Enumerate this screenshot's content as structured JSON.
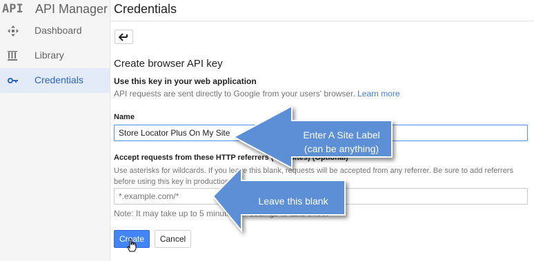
{
  "sidebar": {
    "logo": "API",
    "app_name": "API Manager",
    "items": [
      {
        "label": "Dashboard",
        "icon": "dashboard-icon",
        "active": false
      },
      {
        "label": "Library",
        "icon": "library-icon",
        "active": false
      },
      {
        "label": "Credentials",
        "icon": "key-icon",
        "active": true
      }
    ]
  },
  "header": {
    "title": "Credentials"
  },
  "form": {
    "back_icon": "back-arrow-icon",
    "title": "Create browser API key",
    "section_heading": "Use this key in your web application",
    "help_text": "API requests are sent directly to Google from your users' browser.",
    "learn_more": "Learn more",
    "name_label": "Name",
    "name_value": "Store Locator Plus On My Site",
    "referrers_label": "Accept requests from these HTTP referrers (web sites) (Optional)",
    "referrers_help": "Use asterisks for wildcards. If you leave this blank, requests will be accepted from any referrer. Be sure to add referrers before using this key in production.",
    "referrers_placeholder": "*.example.com/*",
    "note": "Note: It may take up to 5 minutes for settings to take effect",
    "create_label": "Create",
    "cancel_label": "Cancel"
  },
  "annotations": {
    "callout_1_line1": "Enter A Site Label",
    "callout_1_line2": "(can be anything)",
    "callout_2": "Leave this blank"
  },
  "colors": {
    "accent": "#4285f4",
    "link": "#3f7fde",
    "active_nav_bg": "#e4ebf8",
    "callout_fill": "#5b8fd6"
  }
}
